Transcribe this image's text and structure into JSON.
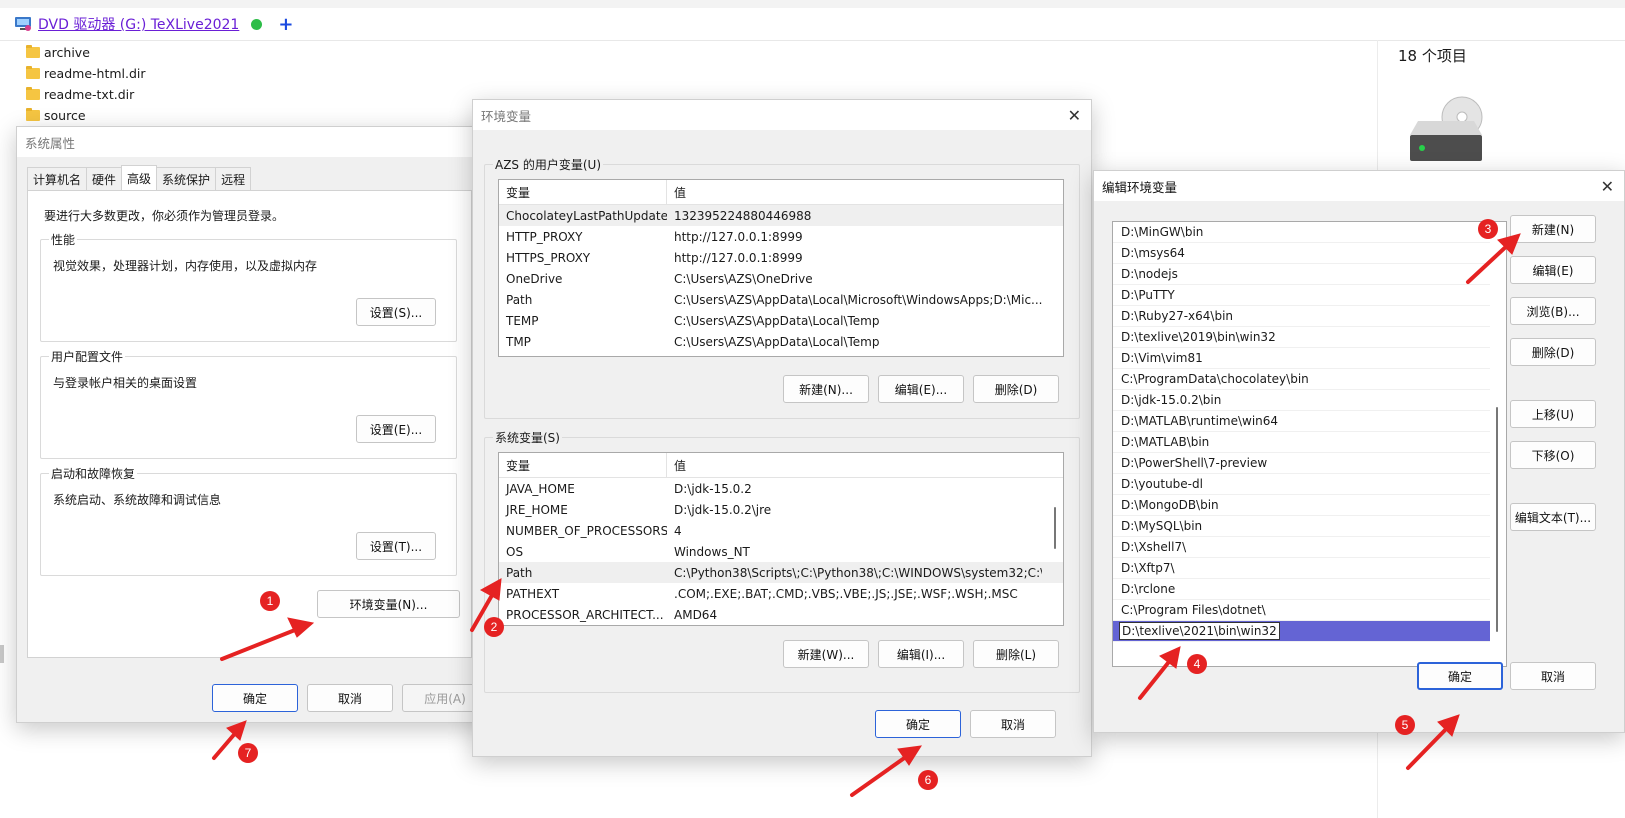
{
  "explorer": {
    "tab_title": "DVD 驱动器 (G:) TeXLive2021",
    "files": [
      "archive",
      "readme-html.dir",
      "readme-txt.dir",
      "source"
    ],
    "item_count": "18 个项目"
  },
  "system_properties": {
    "title": "系统属性",
    "tabs": [
      "计算机名",
      "硬件",
      "高级",
      "系统保护",
      "远程"
    ],
    "active_tab": "高级",
    "admin_note": "要进行大多数更改，你必须作为管理员登录。",
    "performance": {
      "label": "性能",
      "desc": "视觉效果，处理器计划，内存使用，以及虚拟内存",
      "button": "设置(S)..."
    },
    "user_profiles": {
      "label": "用户配置文件",
      "desc": "与登录帐户相关的桌面设置",
      "button": "设置(E)..."
    },
    "startup": {
      "label": "启动和故障恢复",
      "desc": "系统启动、系统故障和调试信息",
      "button": "设置(T)..."
    },
    "env_button": "环境变量(N)...",
    "ok": "确定",
    "cancel": "取消",
    "apply": "应用(A)"
  },
  "env_vars": {
    "title": "环境变量",
    "user_section": "AZS 的用户变量(U)",
    "col_var": "变量",
    "col_val": "值",
    "user_vars": [
      {
        "name": "ChocolateyLastPathUpdate",
        "value": "132395224880446988"
      },
      {
        "name": "HTTP_PROXY",
        "value": "http://127.0.0.1:8999"
      },
      {
        "name": "HTTPS_PROXY",
        "value": "http://127.0.0.1:8999"
      },
      {
        "name": "OneDrive",
        "value": "C:\\Users\\AZS\\OneDrive"
      },
      {
        "name": "Path",
        "value": "C:\\Users\\AZS\\AppData\\Local\\Microsoft\\WindowsApps;D:\\Mic..."
      },
      {
        "name": "TEMP",
        "value": "C:\\Users\\AZS\\AppData\\Local\\Temp"
      },
      {
        "name": "TMP",
        "value": "C:\\Users\\AZS\\AppData\\Local\\Temp"
      }
    ],
    "user_buttons": [
      "新建(N)...",
      "编辑(E)...",
      "删除(D)"
    ],
    "system_section": "系统变量(S)",
    "system_vars": [
      {
        "name": "JAVA_HOME",
        "value": "D:\\jdk-15.0.2"
      },
      {
        "name": "JRE_HOME",
        "value": "D:\\jdk-15.0.2\\jre"
      },
      {
        "name": "NUMBER_OF_PROCESSORS",
        "value": "4"
      },
      {
        "name": "OS",
        "value": "Windows_NT"
      },
      {
        "name": "Path",
        "value": "C:\\Python38\\Scripts\\;C:\\Python38\\;C:\\WINDOWS\\system32;C:\\..."
      },
      {
        "name": "PATHEXT",
        "value": ".COM;.EXE;.BAT;.CMD;.VBS;.VBE;.JS;.JSE;.WSF;.WSH;.MSC"
      },
      {
        "name": "PROCESSOR_ARCHITECT...",
        "value": "AMD64"
      }
    ],
    "system_buttons": [
      "新建(W)...",
      "编辑(I)...",
      "删除(L)"
    ],
    "ok": "确定",
    "cancel": "取消"
  },
  "edit_env": {
    "title": "编辑环境变量",
    "entries": [
      "D:\\MinGW\\bin",
      "D:\\msys64",
      "D:\\nodejs",
      "D:\\PuTTY",
      "D:\\Ruby27-x64\\bin",
      "D:\\texlive\\2019\\bin\\win32",
      "D:\\Vim\\vim81",
      "C:\\ProgramData\\chocolatey\\bin",
      "D:\\jdk-15.0.2\\bin",
      "D:\\MATLAB\\runtime\\win64",
      "D:\\MATLAB\\bin",
      "D:\\PowerShell\\7-preview",
      "D:\\youtube-dl",
      "D:\\MongoDB\\bin",
      "D:\\MySQL\\bin",
      "D:\\Xshell7\\",
      "D:\\Xftp7\\",
      "D:\\rclone",
      "C:\\Program Files\\dotnet\\"
    ],
    "editing_entry": "D:\\texlive\\2021\\bin\\win32",
    "buttons": [
      "新建(N)",
      "编辑(E)",
      "浏览(B)...",
      "删除(D)",
      "上移(U)",
      "下移(O)",
      "编辑文本(T)..."
    ],
    "ok": "确定",
    "cancel": "取消"
  },
  "annotations": {
    "color": "#e52222",
    "steps": [
      "1",
      "2",
      "3",
      "4",
      "5",
      "6",
      "7"
    ]
  }
}
